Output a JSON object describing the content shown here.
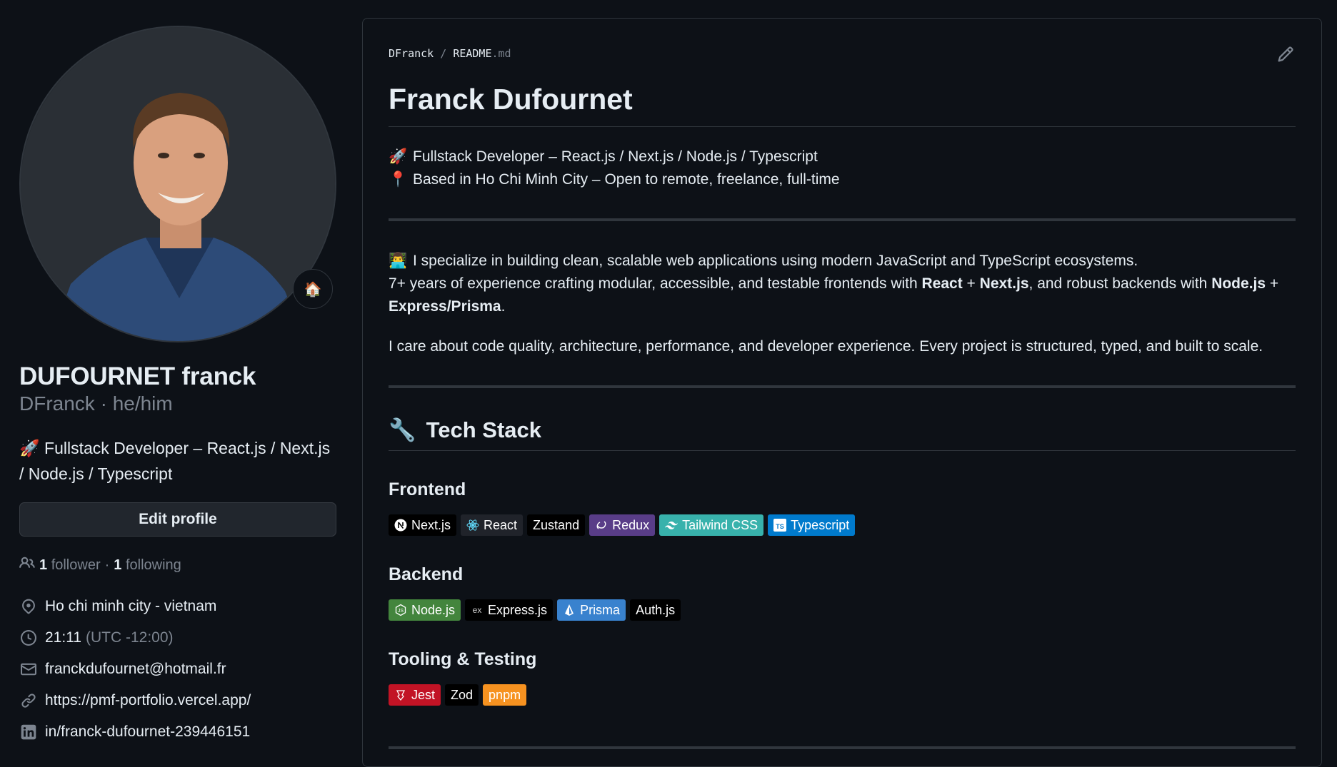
{
  "profile": {
    "full_name": "DUFOURNET franck",
    "username": "DFranck",
    "pronouns": "he/him",
    "status_emoji": "🏠",
    "bio_emoji": "🚀",
    "bio": "Fullstack Developer – React.js / Next.js / Node.js / Typescript",
    "edit_button": "Edit profile",
    "followers_count": "1",
    "followers_label": "follower",
    "following_count": "1",
    "following_label": "following",
    "location": "Ho chi minh city - vietnam",
    "local_time": "21:11",
    "timezone": "(UTC -12:00)",
    "email": "franckdufournet@hotmail.fr",
    "website": "https://pmf-portfolio.vercel.app/",
    "linkedin": "in/franck-dufournet-239446151"
  },
  "readme": {
    "breadcrumb_user": "DFranck",
    "breadcrumb_sep": "/",
    "breadcrumb_file": "README",
    "breadcrumb_ext": ".md",
    "title": "Franck Dufournet",
    "intro": [
      {
        "emoji": "🚀",
        "text": "Fullstack Developer – React.js / Next.js / Node.js / Typescript"
      },
      {
        "emoji": "📍",
        "text": "Based in Ho Chi Minh City – Open to remote, freelance, full-time"
      }
    ],
    "about": {
      "emoji": "👨‍💻",
      "line1": "I specialize in building clean, scalable web applications using modern JavaScript and TypeScript ecosystems.",
      "line2_a": "7+ years of experience crafting modular, accessible, and testable frontends with ",
      "line2_b1": "React",
      "line2_plus1": " + ",
      "line2_b2": "Next.js",
      "line2_c": ", and robust backends with ",
      "line2_b3": "Node.js",
      "line2_plus2": " +",
      "line3_b": "Express/Prisma",
      "line3_end": ".",
      "line4": "I care about code quality, architecture, performance, and developer experience. Every project is structured, typed, and built to scale."
    },
    "tech_stack_emoji": "🔧",
    "tech_stack_title": "Tech Stack",
    "frontend_title": "Frontend",
    "frontend_badges": [
      {
        "label": "Next.js",
        "color": "#000000",
        "icon": "nextjs-icon"
      },
      {
        "label": "React",
        "color": "#20232a",
        "icon": "react-icon"
      },
      {
        "label": "Zustand",
        "color": "#000000",
        "icon": ""
      },
      {
        "label": "Redux",
        "color": "#593d88",
        "icon": "redux-icon"
      },
      {
        "label": "Tailwind CSS",
        "color": "#38b2ac",
        "icon": "tailwind-icon"
      },
      {
        "label": "Typescript",
        "color": "#007acc",
        "icon": "typescript-icon"
      }
    ],
    "backend_title": "Backend",
    "backend_badges": [
      {
        "label": "Node.js",
        "color": "#43853d",
        "icon": "nodejs-icon"
      },
      {
        "label": "Express.js",
        "color": "#000000",
        "icon": "express-icon"
      },
      {
        "label": "Prisma",
        "color": "#3982ce",
        "icon": "prisma-icon"
      },
      {
        "label": "Auth.js",
        "color": "#000000",
        "icon": ""
      }
    ],
    "tooling_title": "Tooling & Testing",
    "tooling_badges": [
      {
        "label": "Jest",
        "color": "#c21325",
        "icon": "jest-icon"
      },
      {
        "label": "Zod",
        "color": "#000000",
        "icon": ""
      },
      {
        "label": "pnpm",
        "color": "#f69220",
        "icon": ""
      }
    ]
  }
}
